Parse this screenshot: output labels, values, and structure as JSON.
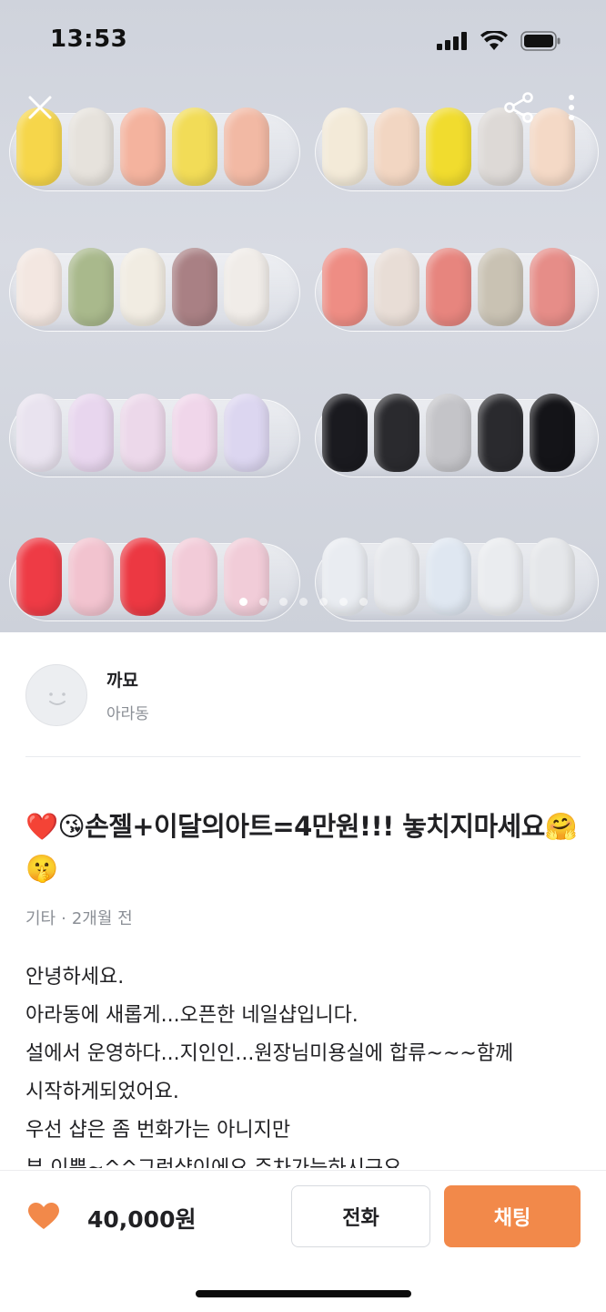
{
  "status_bar": {
    "time": "13:53",
    "location_icon": "location-arrow-icon",
    "signal_icon": "cellular-signal-icon",
    "wifi_icon": "wifi-icon",
    "battery_icon": "battery-icon"
  },
  "toolbar": {
    "close_icon": "close-icon",
    "share_icon": "share-icon",
    "more_icon": "more-vertical-icon"
  },
  "carousel": {
    "slide_count": 7,
    "active_index": 0
  },
  "seller": {
    "name": "까묘",
    "location": "아라동"
  },
  "post": {
    "title": "❤️😘손젤+이달의아트=4만원!!! 놓치지마세요🤗🤫",
    "category": "기타",
    "separator": "·",
    "time_ago": "2개월 전",
    "body_lines": [
      "안녕하세요.",
      "아라동에 새롭게...오픈한 네일샵입니다.",
      "설에서 운영하다...지인인...원장님미용실에 합류~~~함께",
      "시작하게되었어요.",
      "우선 샵은 좀 번화가는 아니지만",
      "뷰 이쁜~^^그런샵이에요.주차가능하시구요."
    ]
  },
  "bottom_bar": {
    "like_icon": "heart-icon",
    "price": "40,000원",
    "call_label": "전화",
    "chat_label": "채팅",
    "accent_color": "#f2894a"
  }
}
